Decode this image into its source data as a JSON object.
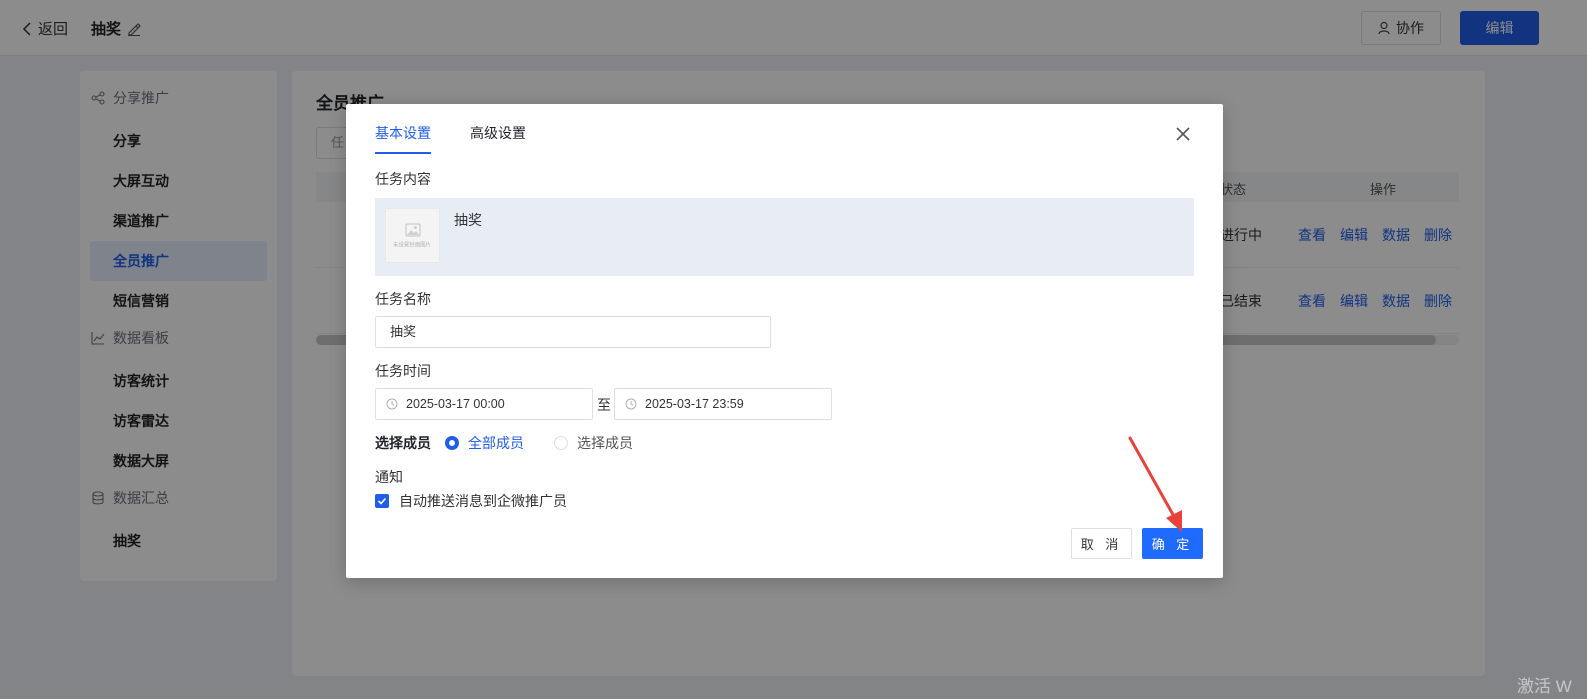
{
  "header": {
    "back_label": "返回",
    "page_title": "抽奖",
    "collab_label": "协作",
    "edit_label": "编辑"
  },
  "sidebar": {
    "groups": [
      {
        "label": "分享推广",
        "icon": "share-icon",
        "items": [
          "分享",
          "大屏互动",
          "渠道推广",
          "全员推广",
          "短信营销"
        ]
      },
      {
        "label": "数据看板",
        "icon": "chart-line-icon",
        "items": [
          "访客统计",
          "访客雷达",
          "数据大屏"
        ]
      },
      {
        "label": "数据汇总",
        "icon": "database-icon",
        "items": [
          "抽奖"
        ]
      }
    ],
    "active_item": "全员推广"
  },
  "main": {
    "title": "全员推广",
    "filter_placeholder": "任",
    "columns": {
      "status": "状态",
      "ops": "操作"
    },
    "rows": [
      {
        "status": "进行中",
        "ops": [
          "查看",
          "编辑",
          "数据",
          "删除"
        ]
      },
      {
        "status": "已结束",
        "ops": [
          "查看",
          "编辑",
          "数据",
          "删除"
        ]
      }
    ]
  },
  "modal": {
    "tabs": [
      "基本设置",
      "高级设置"
    ],
    "active_tab": "基本设置",
    "task_content_label": "任务内容",
    "content_item_name": "抽奖",
    "thumb_caption": "未设置封面图片",
    "task_name_label": "任务名称",
    "task_name_value": "抽奖",
    "task_time_label": "任务时间",
    "start_time": "2025-03-17 00:00",
    "time_separator": "至",
    "end_time": "2025-03-17 23:59",
    "member_label": "选择成员",
    "member_options": [
      {
        "label": "全部成员",
        "selected": true
      },
      {
        "label": "选择成员",
        "selected": false
      }
    ],
    "notify_label": "通知",
    "notify_checkbox_label": "自动推送消息到企微推广员",
    "notify_checked": true,
    "cancel_label": "取 消",
    "confirm_label": "确 定"
  },
  "watermark": "激活 W",
  "colors": {
    "primary": "#1f5dea",
    "confirm": "#1f6bff",
    "annotation_arrow": "#e8423a"
  }
}
